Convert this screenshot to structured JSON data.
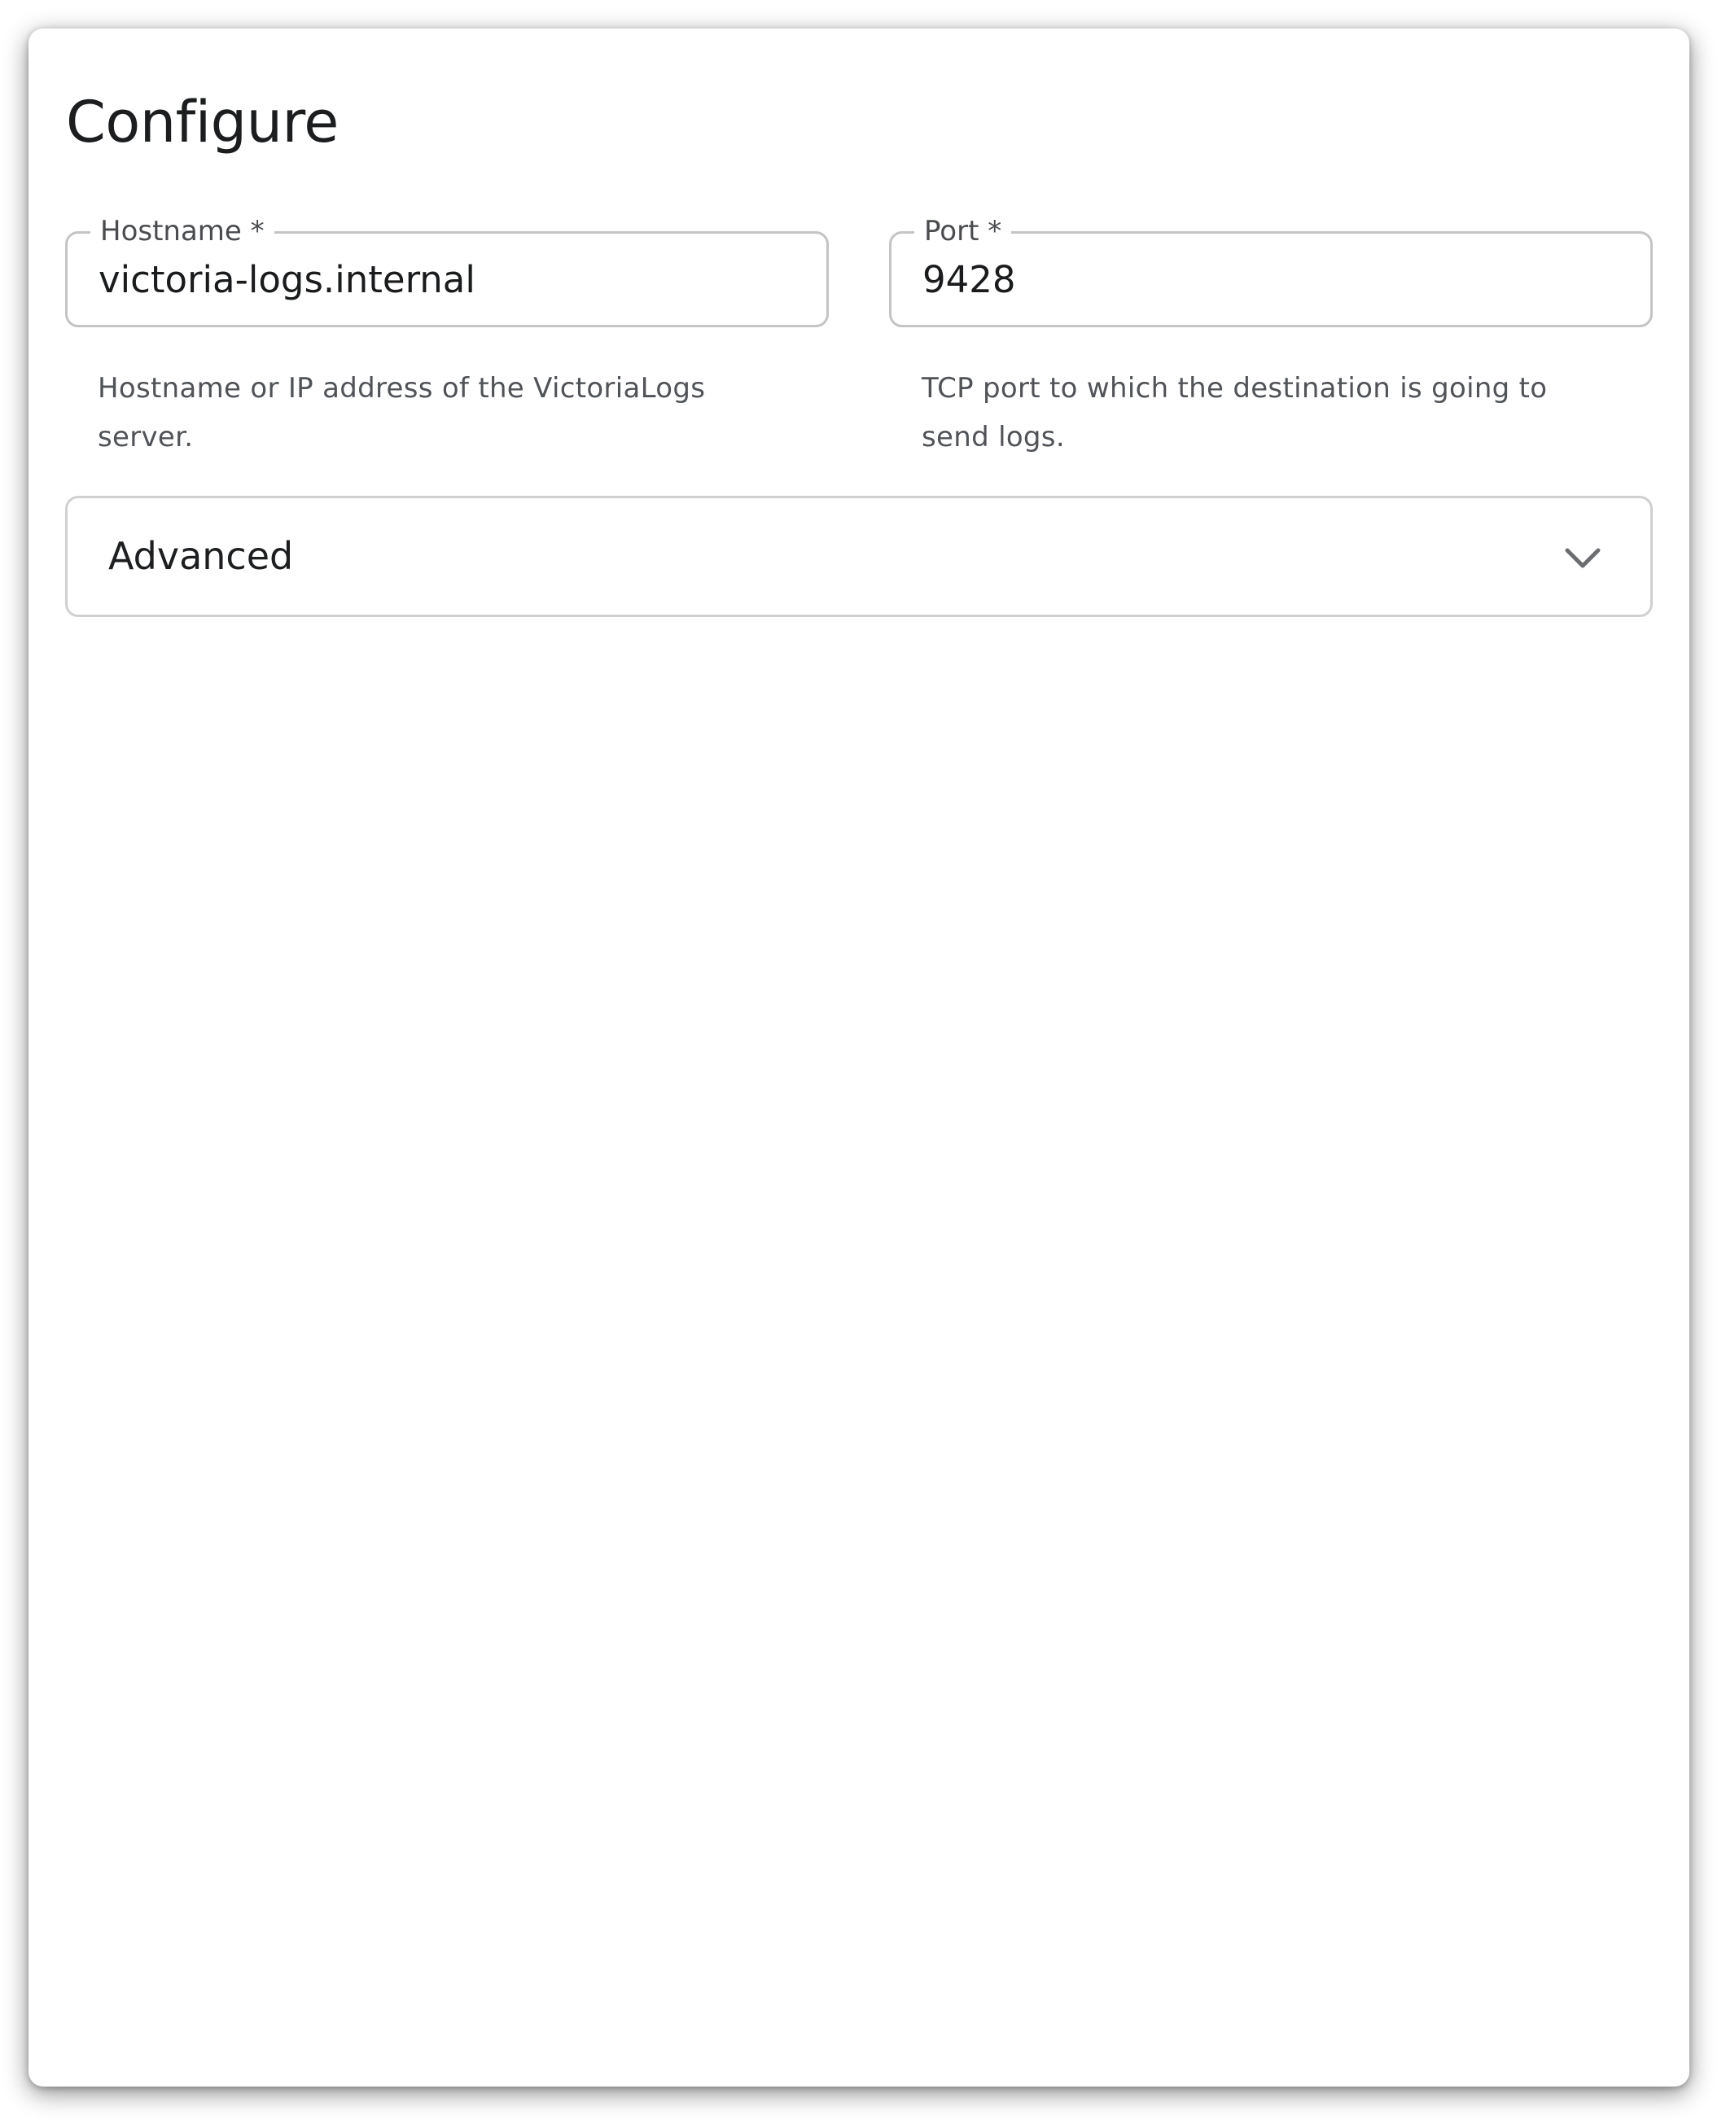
{
  "panel": {
    "title": "Configure"
  },
  "fields": {
    "hostname": {
      "label": "Hostname *",
      "value": "victoria-logs.internal",
      "helper": "Hostname or IP address of the VictoriaLogs server."
    },
    "port": {
      "label": "Port *",
      "value": "9428",
      "helper": "TCP port to which the destination is going to send logs."
    }
  },
  "advanced": {
    "label": "Advanced",
    "expanded": false,
    "icon": "chevron-down-icon"
  }
}
